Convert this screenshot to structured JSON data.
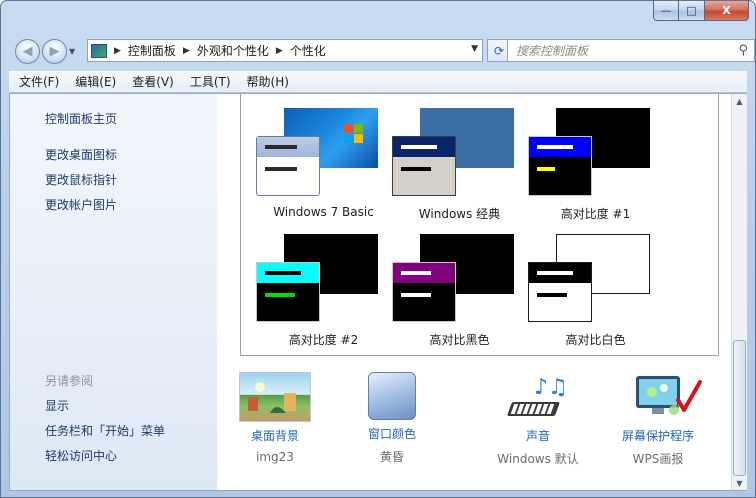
{
  "window": {
    "caption": {
      "minimize": "—",
      "maximize": "□",
      "close": "X"
    }
  },
  "nav": {
    "back_glyph": "◀",
    "forward_glyph": "▶",
    "breadcrumb": [
      "控制面板",
      "外观和个性化",
      "个性化"
    ],
    "refresh_glyph": "⟳",
    "search_placeholder": "搜索控制面板"
  },
  "menubar": [
    "文件(F)",
    "编辑(E)",
    "查看(V)",
    "工具(T)",
    "帮助(H)"
  ],
  "sidebar": {
    "home": "控制面板主页",
    "links": [
      "更改桌面图标",
      "更改鼠标指针",
      "更改帐户图片"
    ],
    "see_also_heading": "另请参阅",
    "see_also": [
      "显示",
      "任务栏和「开始」菜单",
      "轻松访问中心"
    ]
  },
  "themes": [
    {
      "label": "Windows 7 Basic"
    },
    {
      "label": "Windows 经典"
    },
    {
      "label": "高对比度 #1"
    },
    {
      "label": "高对比度 #2"
    },
    {
      "label": "高对比黑色"
    },
    {
      "label": "高对比白色"
    }
  ],
  "bottom": [
    {
      "title": "桌面背景",
      "value": "img23",
      "icon": "desktop-background-icon"
    },
    {
      "title": "窗口颜色",
      "value": "黄昏",
      "icon": "window-color-icon"
    },
    {
      "title": "声音",
      "value": "Windows 默认",
      "icon": "sound-icon"
    },
    {
      "title": "屏幕保护程序",
      "value": "WPS画报",
      "icon": "screensaver-icon"
    }
  ],
  "colors": {
    "link": "#1f67b5",
    "sidebar_link": "#1f3a6a",
    "annotation_check": "#e0101a"
  }
}
